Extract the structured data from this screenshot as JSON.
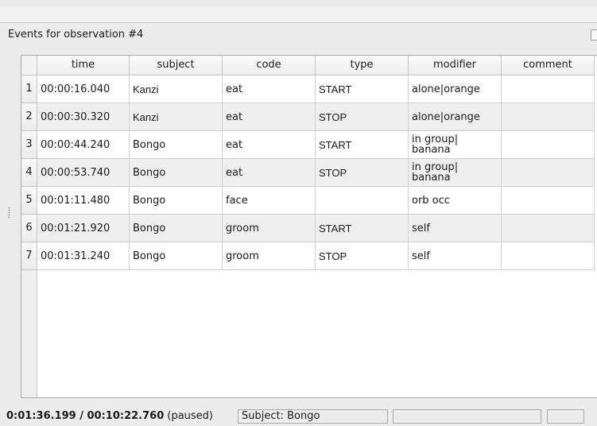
{
  "dock": {
    "title": "Events for observation #4"
  },
  "table": {
    "columns": [
      "time",
      "subject",
      "code",
      "type",
      "modifier",
      "comment"
    ],
    "rows": [
      {
        "num": "1",
        "time": "00:00:16.040",
        "subject": "Kanzi",
        "code": "eat",
        "type": "START",
        "modifier": "alone|orange",
        "comment": ""
      },
      {
        "num": "2",
        "time": "00:00:30.320",
        "subject": "Kanzi",
        "code": "eat",
        "type": "STOP",
        "modifier": "alone|orange",
        "comment": ""
      },
      {
        "num": "3",
        "time": "00:00:44.240",
        "subject": "Bongo",
        "code": "eat",
        "type": "START",
        "modifier": "in group|\nbanana",
        "comment": ""
      },
      {
        "num": "4",
        "time": "00:00:53.740",
        "subject": "Bongo",
        "code": "eat",
        "type": "STOP",
        "modifier": "in group|\nbanana",
        "comment": ""
      },
      {
        "num": "5",
        "time": "00:01:11.480",
        "subject": "Bongo",
        "code": "face",
        "type": "",
        "modifier": "orb occ",
        "comment": ""
      },
      {
        "num": "6",
        "time": "00:01:21.920",
        "subject": "Bongo",
        "code": "groom",
        "type": "START",
        "modifier": "self",
        "comment": ""
      },
      {
        "num": "7",
        "time": "00:01:31.240",
        "subject": "Bongo",
        "code": "groom",
        "type": "STOP",
        "modifier": "self",
        "comment": ""
      }
    ]
  },
  "status": {
    "time": "0:01:36.199 / 00:10:22.760",
    "state": " (paused)",
    "subject": "Subject: Bongo",
    "box2": "",
    "box3": ""
  }
}
